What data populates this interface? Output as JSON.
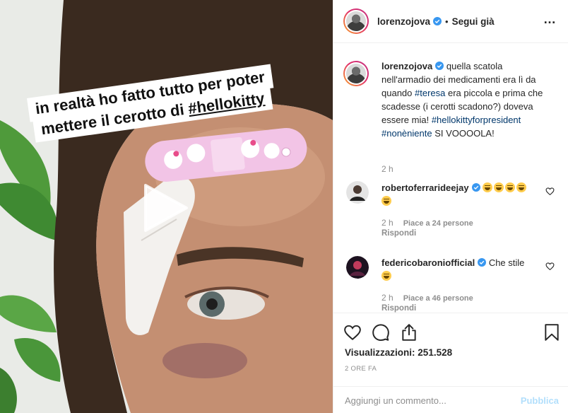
{
  "media": {
    "caption_line1": "in realtà ho fatto tutto per poter",
    "caption_line2_prefix": "mettere il cerotto di ",
    "caption_line2_tag": "#hellokitty"
  },
  "post": {
    "username": "lorenzojova",
    "separator": "•",
    "follow_label": "Segui già",
    "caption_username": "lorenzojova",
    "caption_text1": " quella scatola nell'armadio dei medicamenti era lì da quando ",
    "caption_tag_teresa": "#teresa",
    "caption_text2": " era piccola e prima che scadesse (i cerotti scadono?) doveva essere mia! ",
    "caption_tag_hk": "#hellokittyforpresident",
    "caption_space": " ",
    "caption_tag_non": "#nonèniente",
    "caption_text3": " SI VOOOOLA!",
    "caption_time": "2 h"
  },
  "comments": [
    {
      "username": "robertoferrarideejay",
      "time": "2 h",
      "likes": "Piace a 24 persone",
      "reply": "Rispondi"
    },
    {
      "username": "federicobaroniofficial",
      "text": " Che stile ",
      "time": "2 h",
      "likes": "Piace a 46 persone",
      "reply": "Rispondi"
    }
  ],
  "stats": {
    "views_label": "Visualizzazioni:",
    "views_value": "251.528",
    "time_ago": "2 ORE FA"
  },
  "comment_input": {
    "placeholder": "Aggiungi un commento...",
    "publish_label": "Pubblica"
  },
  "colors": {
    "link": "#00376b",
    "verified": "#3897f0",
    "publish_disabled": "#b2dffc",
    "muted": "#8e8e8e"
  }
}
